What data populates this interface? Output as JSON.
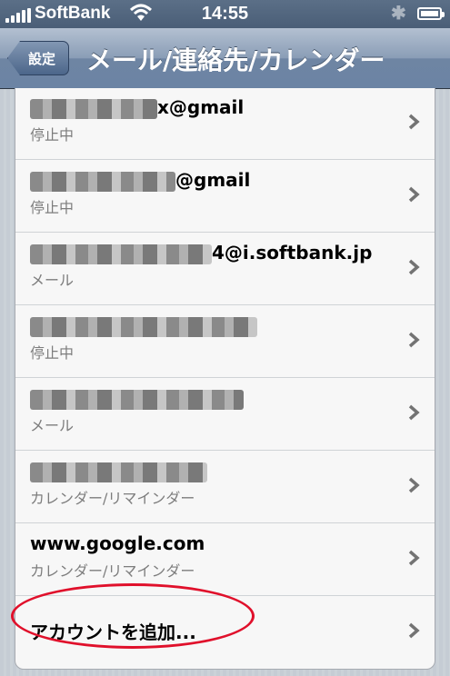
{
  "status": {
    "carrier": "SoftBank",
    "time": "14:55"
  },
  "nav": {
    "back_label": "設定",
    "title": "メール/連絡先/カレンダー"
  },
  "accounts": [
    {
      "primary": "x@gmail",
      "secondary": "停止中"
    },
    {
      "primary": "@gmail",
      "secondary": "停止中"
    },
    {
      "primary": "4@i.softbank.jp",
      "secondary": "メール"
    },
    {
      "primary": "",
      "secondary": "停止中"
    },
    {
      "primary": "",
      "secondary": "メール"
    },
    {
      "primary": "",
      "secondary": "カレンダー/リマインダー"
    },
    {
      "primary": "www.google.com",
      "secondary": "カレンダー/リマインダー"
    }
  ],
  "add_account_label": "アカウントを追加...",
  "colors": {
    "annotation": "#e0102b",
    "nav": "#6c84a4"
  },
  "icons": [
    "signal-icon",
    "wifi-icon",
    "bluetooth-icon",
    "battery-icon",
    "chevron-right-icon"
  ]
}
